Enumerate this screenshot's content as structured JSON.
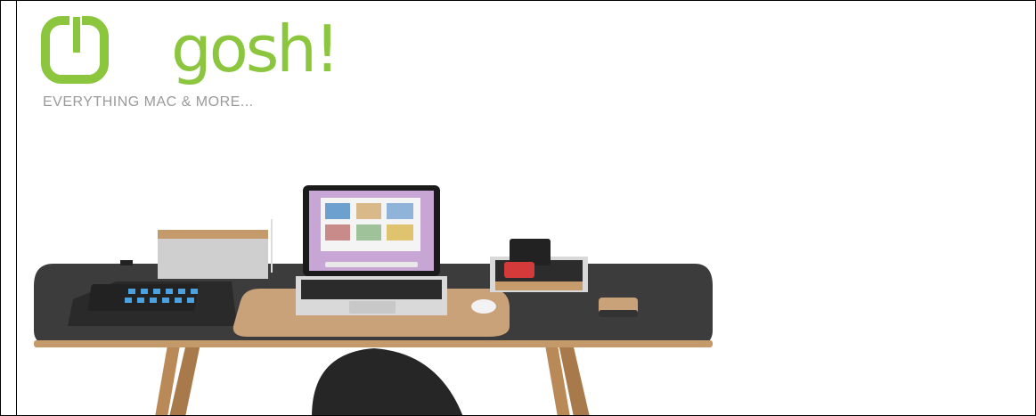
{
  "header": {
    "brand_name": "gosh!",
    "tagline": "EVERYTHING MAC & MORE...",
    "logo_icon": "power-clock-icon"
  },
  "hero": {
    "scene": "desk-setup-image",
    "colors": {
      "brand_green": "#8cc63f",
      "desk_top": "#3c3c3c",
      "cork": "#c9a27a",
      "wood": "#b98a58"
    }
  }
}
